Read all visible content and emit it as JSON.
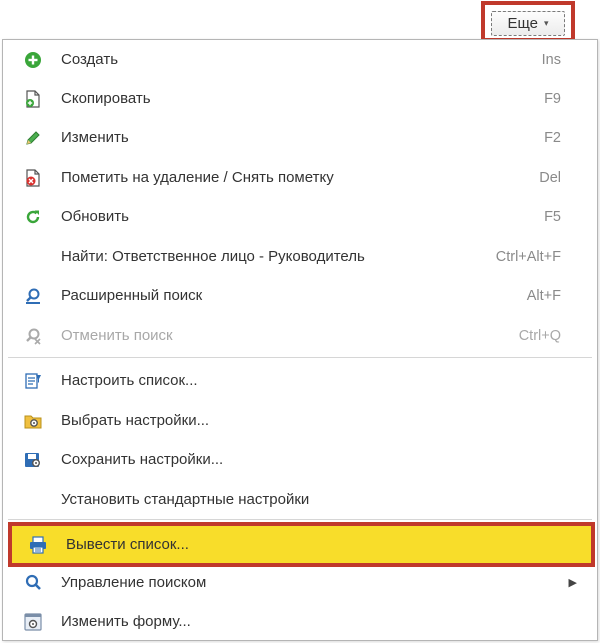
{
  "more_button": {
    "label": "Еще",
    "caret": "▾"
  },
  "menu": {
    "items": [
      {
        "label": "Создать",
        "shortcut": "Ins",
        "icon": "plus-circle-icon"
      },
      {
        "label": "Скопировать",
        "shortcut": "F9",
        "icon": "copy-icon"
      },
      {
        "label": "Изменить",
        "shortcut": "F2",
        "icon": "pencil-icon"
      },
      {
        "label": "Пометить на удаление / Снять пометку",
        "shortcut": "Del",
        "icon": "delete-mark-icon"
      },
      {
        "label": "Обновить",
        "shortcut": "F5",
        "icon": "refresh-icon"
      },
      {
        "label": "Найти: Ответственное лицо - Руководитель",
        "shortcut": "Ctrl+Alt+F"
      },
      {
        "label": "Расширенный поиск",
        "shortcut": "Alt+F",
        "icon": "advanced-search-icon"
      },
      {
        "label": "Отменить поиск",
        "shortcut": "Ctrl+Q",
        "icon": "cancel-search-icon",
        "disabled": true
      },
      {
        "label": "Настроить список...",
        "icon": "list-settings-icon"
      },
      {
        "label": "Выбрать настройки...",
        "icon": "select-settings-icon"
      },
      {
        "label": "Сохранить настройки...",
        "icon": "save-settings-icon"
      },
      {
        "label": "Установить стандартные настройки"
      },
      {
        "label": "Вывести список...",
        "icon": "print-list-icon",
        "highlighted": true
      },
      {
        "label": "Управление поиском",
        "icon": "search-icon",
        "submenu_arrow": "▶"
      },
      {
        "label": "Изменить форму...",
        "icon": "form-icon"
      }
    ]
  },
  "colors": {
    "highlight_fill": "#f8dd2a",
    "highlight_border": "#c0392b",
    "green": "#3aa63a",
    "blue": "#2f6db5"
  }
}
